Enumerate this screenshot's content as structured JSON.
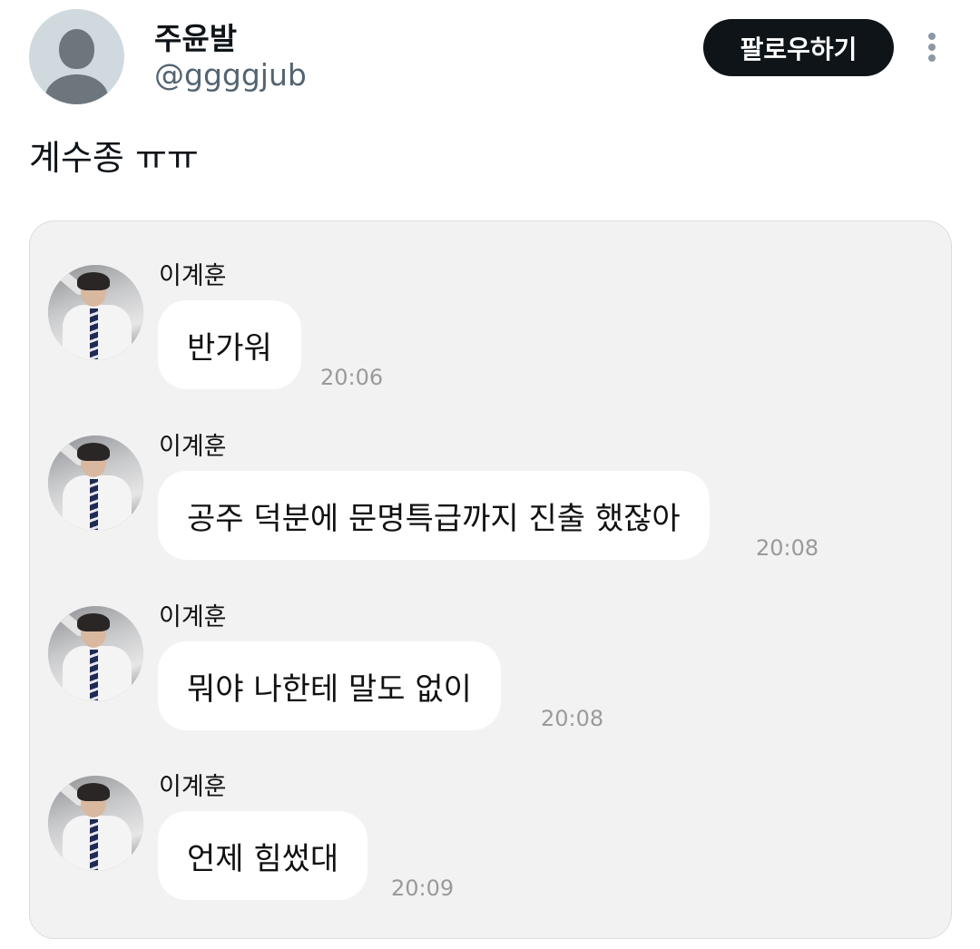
{
  "user": {
    "display_name": "주윤발",
    "handle": "@ggggjub"
  },
  "header": {
    "follow_label": "팔로우하기",
    "more_icon": "more-vertical-icon"
  },
  "tweet": {
    "text": "계수종 ㅠㅠ"
  },
  "chat": {
    "messages": [
      {
        "sender": "이계훈",
        "text": "반가워",
        "time": "20:06"
      },
      {
        "sender": "이계훈",
        "text": "공주 덕분에 문명특급까지 진출 했잖아",
        "time": "20:08"
      },
      {
        "sender": "이계훈",
        "text": "뭐야 나한테 말도 없이",
        "time": "20:08"
      },
      {
        "sender": "이계훈",
        "text": "언제 힘썼대",
        "time": "20:09"
      }
    ]
  },
  "colors": {
    "follow_bg": "#0f1419",
    "card_bg": "#f2f2f2",
    "bubble_bg": "#ffffff",
    "timestamp": "#9a9a9a",
    "handle": "#536471"
  }
}
